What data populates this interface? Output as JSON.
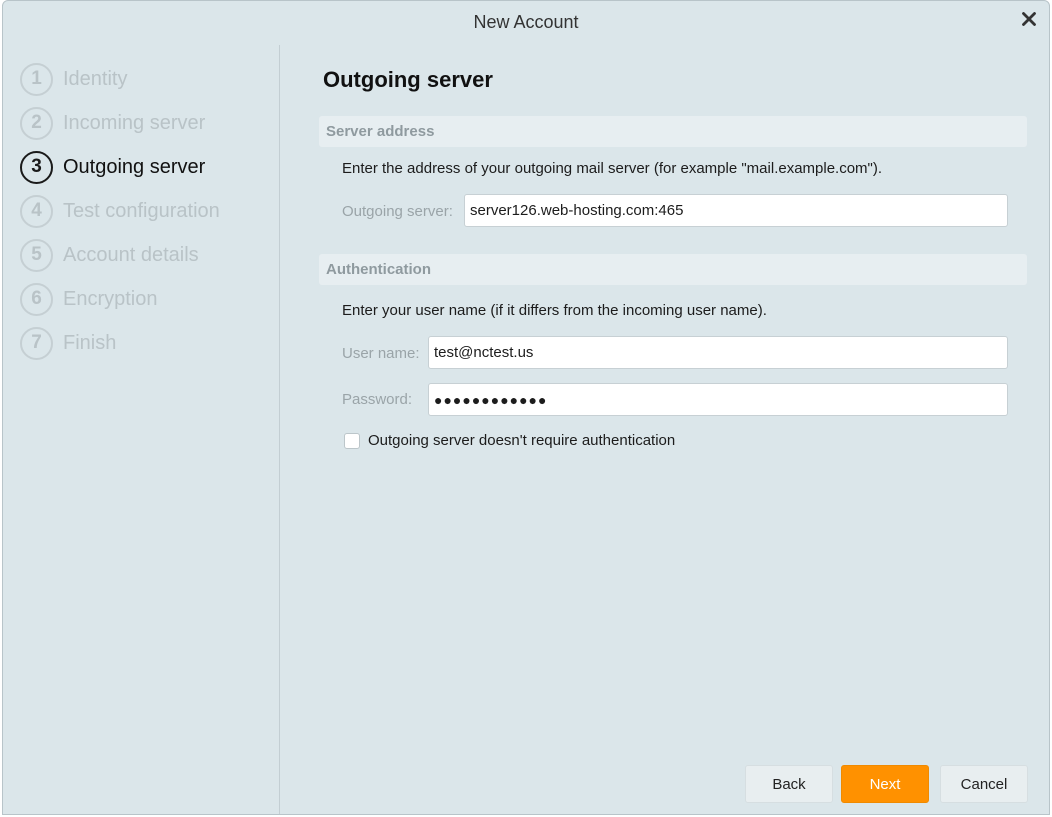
{
  "window": {
    "title": "New Account"
  },
  "steps": [
    {
      "number": "1",
      "label": "Identity",
      "state": "inactive"
    },
    {
      "number": "2",
      "label": "Incoming server",
      "state": "inactive"
    },
    {
      "number": "3",
      "label": "Outgoing server",
      "state": "active"
    },
    {
      "number": "4",
      "label": "Test configuration",
      "state": "inactive"
    },
    {
      "number": "5",
      "label": "Account details",
      "state": "inactive"
    },
    {
      "number": "6",
      "label": "Encryption",
      "state": "inactive"
    },
    {
      "number": "7",
      "label": "Finish",
      "state": "inactive"
    }
  ],
  "page": {
    "title": "Outgoing server"
  },
  "server_address": {
    "header": "Server address",
    "description": "Enter the address of your outgoing mail server (for example \"mail.example.com\").",
    "outgoing_server_label": "Outgoing server:",
    "outgoing_server_value": "server126.web-hosting.com:465"
  },
  "authentication": {
    "header": "Authentication",
    "description": "Enter your user name (if it differs from the incoming user name).",
    "username_label": "User name:",
    "username_value": "test@nctest.us",
    "password_label": "Password:",
    "password_value": "●●●●●●●●●●●●",
    "no_auth_checkbox_label": "Outgoing server doesn't require authentication",
    "no_auth_checked": false
  },
  "buttons": {
    "back": "Back",
    "next": "Next",
    "cancel": "Cancel"
  },
  "colors": {
    "background": "#dbe6ea",
    "accent": "#ff9100",
    "section_header_bg": "#e7eef1"
  },
  "icons": {
    "close": "close-icon"
  }
}
